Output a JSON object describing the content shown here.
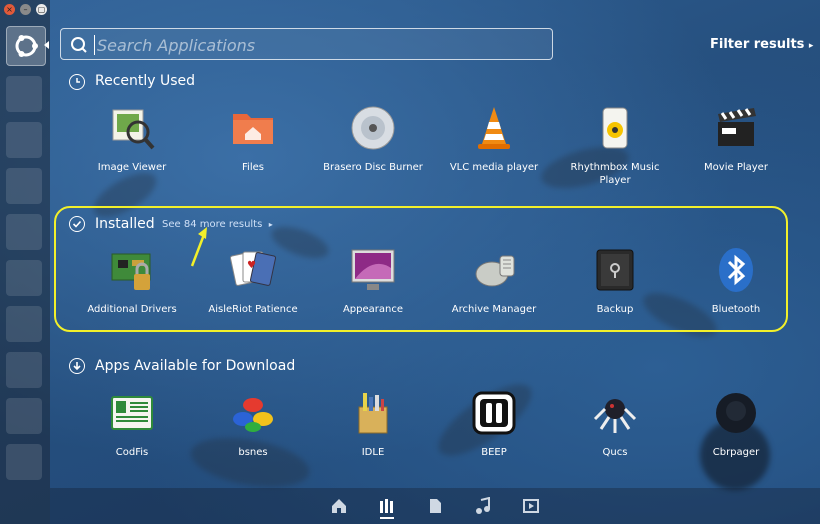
{
  "search": {
    "placeholder": "Search Applications"
  },
  "filter_label": "Filter results",
  "sections": {
    "recent": {
      "title": "Recently Used"
    },
    "installed": {
      "title": "Installed",
      "more": "See 84 more results"
    },
    "download": {
      "title": "Apps Available for Download"
    }
  },
  "apps": {
    "recent": [
      {
        "label": "Image Viewer"
      },
      {
        "label": "Files"
      },
      {
        "label": "Brasero Disc Burner"
      },
      {
        "label": "VLC media player"
      },
      {
        "label": "Rhythmbox Music Player"
      },
      {
        "label": "Movie Player"
      }
    ],
    "installed": [
      {
        "label": "Additional Drivers"
      },
      {
        "label": "AisleRiot Patience"
      },
      {
        "label": "Appearance"
      },
      {
        "label": "Archive Manager"
      },
      {
        "label": "Backup"
      },
      {
        "label": "Bluetooth"
      }
    ],
    "download": [
      {
        "label": "CodFis"
      },
      {
        "label": "bsnes"
      },
      {
        "label": "IDLE"
      },
      {
        "label": "BEEP"
      },
      {
        "label": "Qucs"
      },
      {
        "label": "Cbrpager"
      }
    ]
  },
  "colors": {
    "highlight": "#f2f02a",
    "accent_orange": "#e8673a"
  }
}
